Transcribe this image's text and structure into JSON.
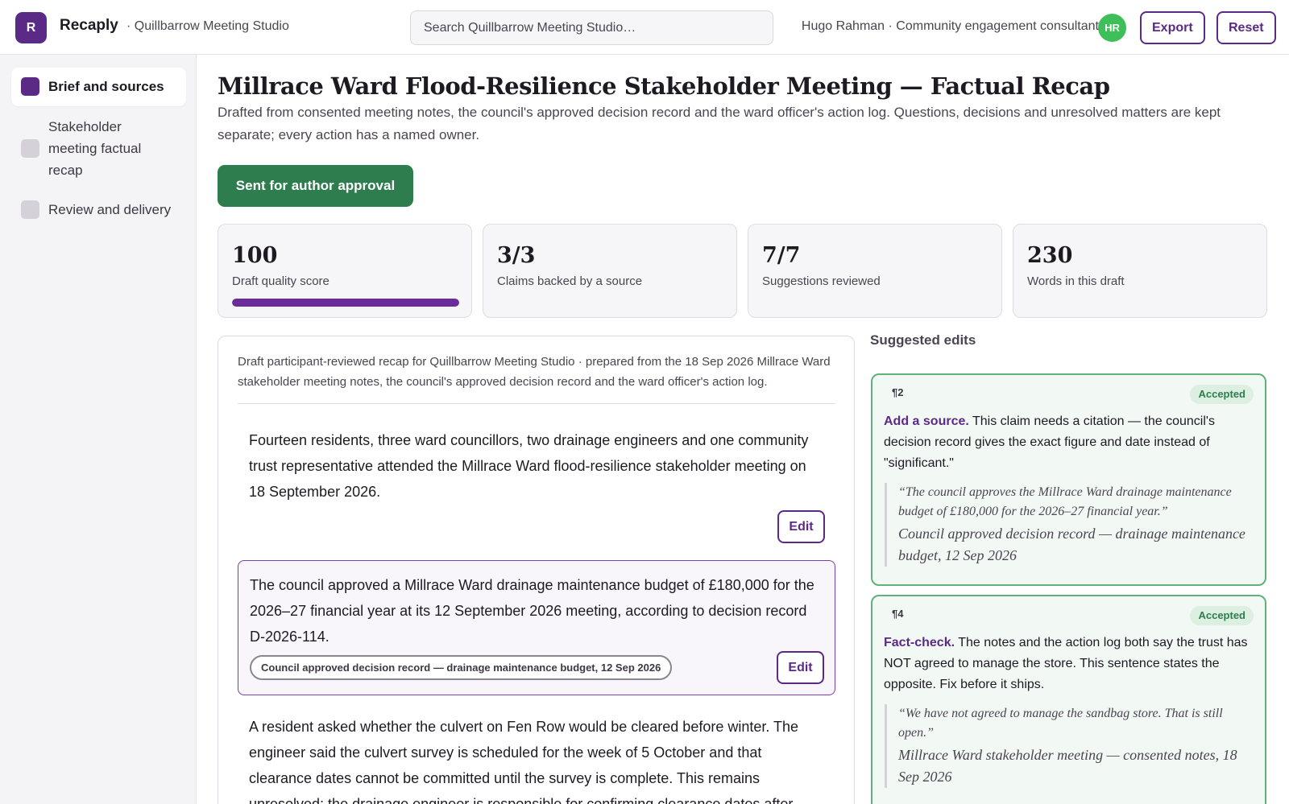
{
  "app": {
    "logo_letter": "R",
    "brand": "Recaply",
    "studio": "· Quillbarrow Meeting Studio",
    "search_placeholder": "Search Quillbarrow Meeting Studio…",
    "user": "Hugo Rahman · Community engagement consultant",
    "avatar_initials": "HR",
    "export_label": "Export",
    "reset_label": "Reset",
    "accent_color": "#5b2a86",
    "success_color": "#2e7d4f"
  },
  "sidebar": {
    "items": [
      {
        "label": "Brief and sources",
        "active": true
      },
      {
        "label": "Stakeholder meeting factual recap",
        "active": false
      },
      {
        "label": "Review and delivery",
        "active": false
      }
    ]
  },
  "main": {
    "title": "Millrace Ward Flood-Resilience Stakeholder Meeting — Factual Recap",
    "subtitle": "Drafted from consented meeting notes, the council's approved decision record and the ward officer's action log. Questions, decisions and unresolved matters are kept separate; every action has a named owner.",
    "status_button": "Sent for author approval",
    "stats": [
      {
        "value": "100",
        "label": "Draft quality score",
        "progress_percent": 100
      },
      {
        "value": "3/3",
        "label": "Claims backed by a source"
      },
      {
        "value": "7/7",
        "label": "Suggestions reviewed"
      },
      {
        "value": "230",
        "label": "Words in this draft"
      }
    ]
  },
  "draft": {
    "intro": "Draft participant-reviewed recap for Quillbarrow Meeting Studio · prepared from the 18 Sep 2026 Millrace Ward stakeholder meeting notes, the council's approved decision record and the ward officer's action log.",
    "edit_label": "Edit",
    "paragraphs": [
      {
        "text": "Fourteen residents, three ward councillors, two drainage engineers and one community trust representative attended the Millrace Ward flood-resilience stakeholder meeting on 18 September 2026."
      },
      {
        "text": "The council approved a Millrace Ward drainage maintenance budget of £180,000 for the 2026–27 financial year at its 12 September 2026 meeting, according to decision record D-2026-114.",
        "source": "Council approved decision record — drainage maintenance budget, 12 Sep 2026"
      },
      {
        "text": "A resident asked whether the culvert on Fen Row would be cleared before winter. The engineer said the culvert survey is scheduled for the week of 5 October and that clearance dates cannot be committed until the survey is complete. This remains unresolved; the drainage engineer is responsible for confirming clearance dates after"
      }
    ]
  },
  "suggestions": {
    "heading": "Suggested edits",
    "items": [
      {
        "ref": "¶2",
        "status": "Accepted",
        "kicker": "Add a source.",
        "body": " This claim needs a citation — the council's decision record gives the exact figure and date instead of \"significant.\"",
        "quote": "“The council approves the Millrace Ward drainage maintenance budget of £180,000 for the 2026–27 financial year.”",
        "quote_source": "Council approved decision record — drainage maintenance budget, 12 Sep 2026"
      },
      {
        "ref": "¶4",
        "status": "Accepted",
        "kicker": "Fact-check.",
        "body": " The notes and the action log both say the trust has NOT agreed to manage the store. This sentence states the opposite. Fix before it ships.",
        "quote": "“We have not agreed to manage the sandbag store. That is still open.”",
        "quote_source": "Millrace Ward stakeholder meeting — consented notes, 18 Sep 2026"
      }
    ]
  }
}
